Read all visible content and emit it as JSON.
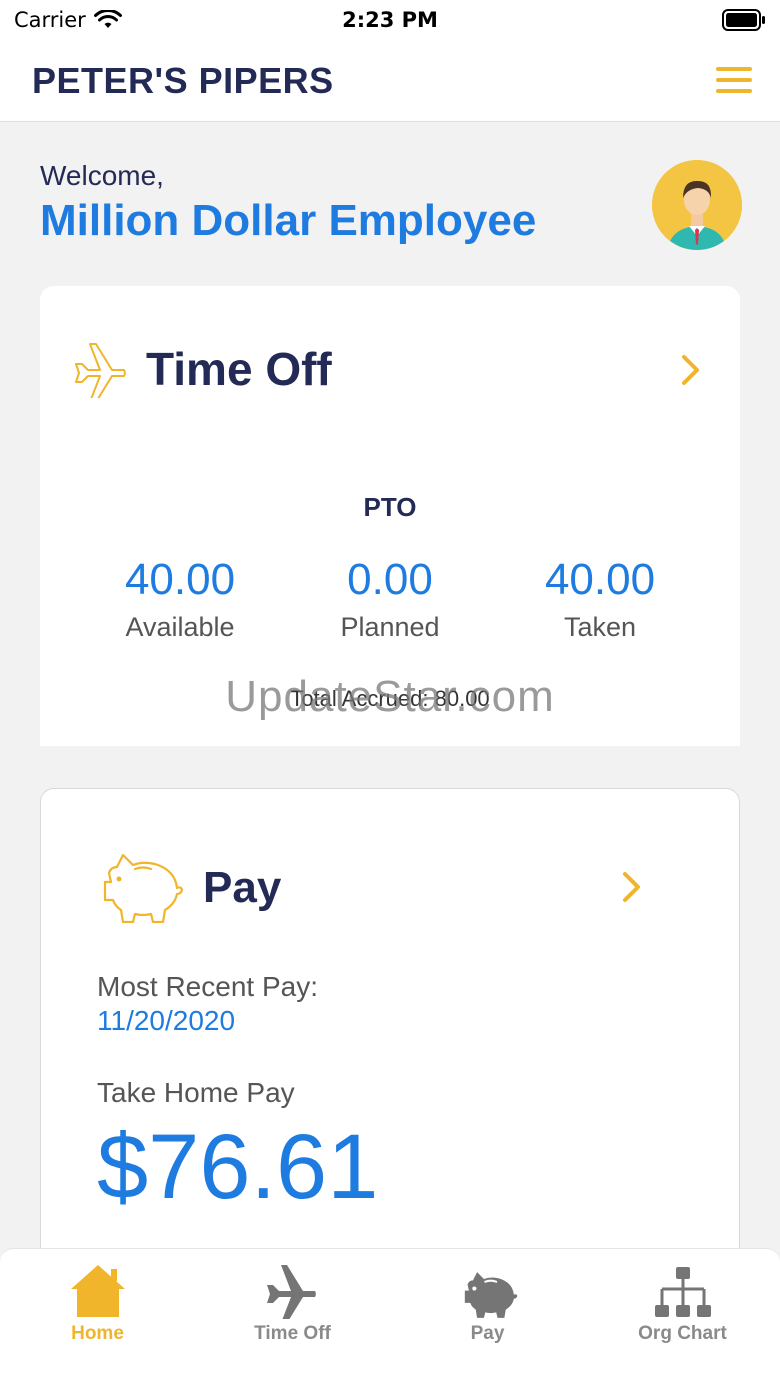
{
  "status_bar": {
    "carrier": "Carrier",
    "time": "2:23 PM"
  },
  "header": {
    "brand": "PETER'S PIPERS",
    "menu_icon": "hamburger-menu-icon"
  },
  "welcome": {
    "greeting": "Welcome,",
    "name": "Million Dollar Employee",
    "avatar_icon": "employee-avatar-icon"
  },
  "time_off": {
    "title": "Time Off",
    "icon": "airplane-icon",
    "section_label": "PTO",
    "stats": [
      {
        "value": "40.00",
        "label": "Available"
      },
      {
        "value": "0.00",
        "label": "Planned"
      },
      {
        "value": "40.00",
        "label": "Taken"
      }
    ],
    "total_accrued": "Total Accrued: 80.00"
  },
  "watermark": "UpdateStar.com",
  "pay": {
    "title": "Pay",
    "icon": "piggy-bank-icon",
    "recent_label": "Most Recent Pay:",
    "recent_date": "11/20/2020",
    "take_home_label": "Take Home Pay",
    "take_home_amount": "$76.61"
  },
  "tabs": [
    {
      "label": "Home",
      "icon": "home-icon",
      "active": true
    },
    {
      "label": "Time Off",
      "icon": "airplane-icon",
      "active": false
    },
    {
      "label": "Pay",
      "icon": "piggy-bank-icon",
      "active": false
    },
    {
      "label": "Org Chart",
      "icon": "org-chart-icon",
      "active": false
    }
  ],
  "colors": {
    "accent": "#f0b52a",
    "primary": "#1e7be0",
    "navy": "#222a55"
  }
}
